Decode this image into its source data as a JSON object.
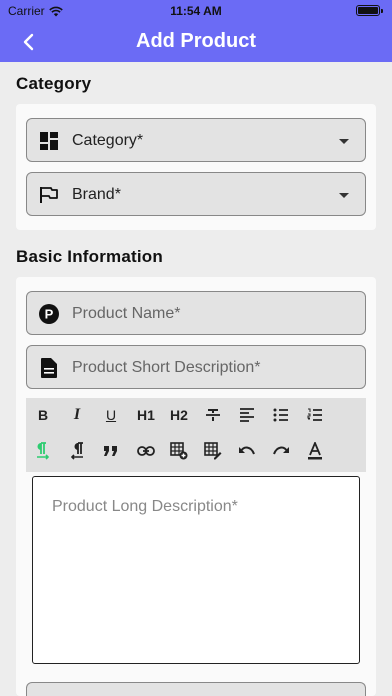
{
  "status": {
    "carrier": "Carrier",
    "time": "11:54 AM"
  },
  "header": {
    "title": "Add Product",
    "back_icon": "chevron-left-icon"
  },
  "sections": {
    "category": {
      "title": "Category",
      "fields": {
        "category": {
          "label": "Category*",
          "icon": "dashboard-icon"
        },
        "brand": {
          "label": "Brand*",
          "icon": "flag-icon"
        }
      }
    },
    "basic": {
      "title": "Basic Information",
      "fields": {
        "name": {
          "placeholder": "Product Name*",
          "icon": "product-p-icon"
        },
        "short_desc": {
          "placeholder": "Product Short Description*",
          "icon": "document-icon"
        }
      },
      "toolbar": {
        "bold": "B",
        "italic": "I",
        "underline": "U",
        "h1": "H1",
        "h2": "H2"
      },
      "long_desc": {
        "placeholder": "Product Long Description*"
      }
    }
  },
  "colors": {
    "primary": "#6b6bf5",
    "active_tool": "#2ecc71"
  }
}
